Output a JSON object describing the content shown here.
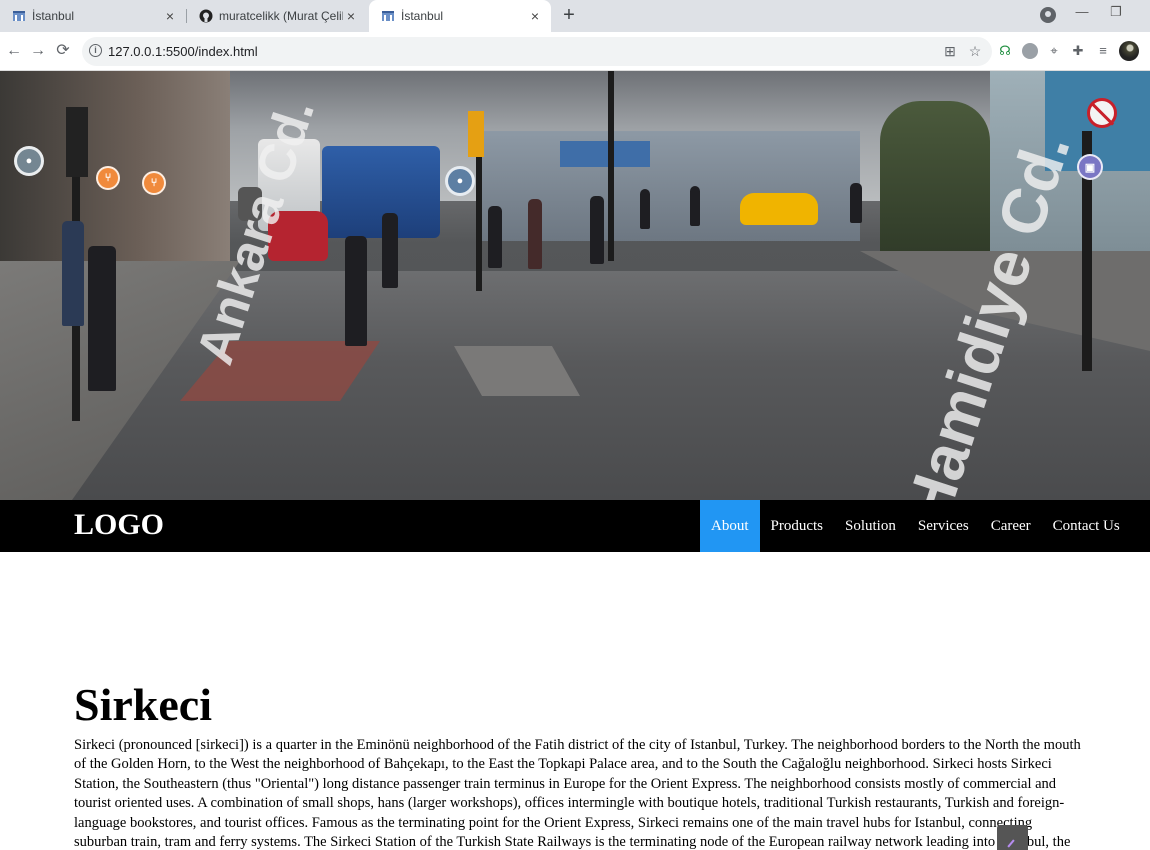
{
  "browser": {
    "tabs": [
      {
        "title": "İstanbul",
        "icon": "page-favicon-icon"
      },
      {
        "title": "muratcelikk (Murat Çelik)",
        "icon": "github-icon"
      },
      {
        "title": "İstanbul",
        "icon": "page-favicon-icon"
      }
    ],
    "active_tab": 2,
    "close_glyph": "×",
    "new_tab_glyph": "+",
    "url": "127.0.0.1:5500/index.html"
  },
  "hero": {
    "street_left": "Ankara Cd.",
    "street_right": "Hamidiye Cd."
  },
  "navbar": {
    "logo": "LOGO",
    "items": [
      "About",
      "Products",
      "Solution",
      "Services",
      "Career",
      "Contact Us"
    ],
    "active_item": "About",
    "accent": "#2196f3"
  },
  "content": {
    "title": "Sirkeci",
    "paragraph": "Sirkeci (pronounced [sirkeci]) is a quarter in the Eminönü neighborhood of the Fatih district of the city of Istanbul, Turkey. The neighborhood borders to the North the mouth of the Golden Horn, to the West the neighborhood of Bahçekapı, to the East the Topkapi Palace area, and to the South the Cağaloğlu neighborhood. Sirkeci hosts Sirkeci Station, the Southeastern (thus \"Oriental\") long distance passenger train terminus in Europe for the Orient Express. The neighborhood consists mostly of commercial and tourist oriented uses. A combination of small shops, hans (larger workshops), offices intermingle with boutique hotels, traditional Turkish restaurants, Turkish and foreign-language bookstores, and tourist offices. Famous as the terminating point for the Orient Express, Sirkeci remains one of the main travel hubs for Istanbul, connecting suburban train, tram and ferry systems. The Sirkeci Station of the Turkish State Railways is the terminating node of the European railway network leading into Istanbul, the two main lines from Thessaloniki, Greece and Bucharest, Romania. Moreover, this is the terminal of the suburban railway line leading to Halkalı along the Marmara shore. The Marmaray project, an underwater"
  }
}
